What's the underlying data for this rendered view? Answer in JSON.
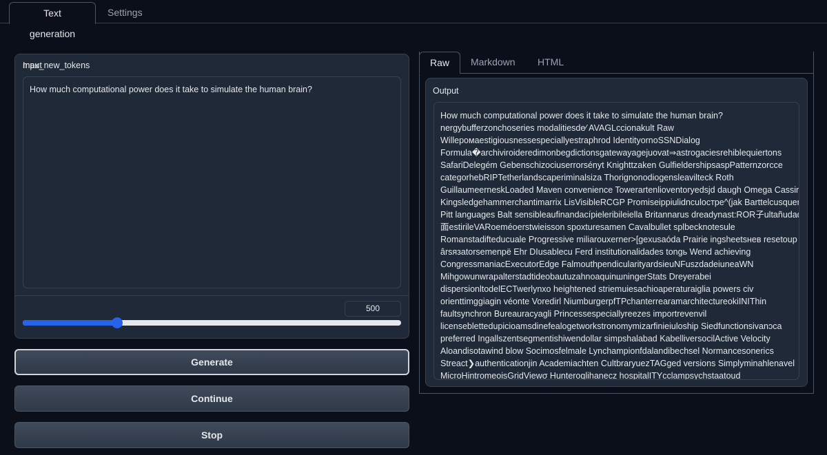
{
  "top_tabs": [
    {
      "label": "Text generation",
      "active": true
    },
    {
      "label": "Settings",
      "active": false
    }
  ],
  "input_panel": {
    "label": "Input",
    "text": "How much computational power does it take to simulate the human brain?"
  },
  "slider": {
    "label": "max_new_tokens",
    "value": "500",
    "fraction": 0.25
  },
  "buttons": {
    "generate": "Generate",
    "continue": "Continue",
    "stop": "Stop"
  },
  "output_tabs": [
    {
      "label": "Raw",
      "active": true
    },
    {
      "label": "Markdown",
      "active": false
    },
    {
      "label": "HTML",
      "active": false
    }
  ],
  "output_panel": {
    "label": "Output",
    "lines": [
      "How much computational power does it take to simulate the human brain?",
      "nergybufferzonchoseries modalitiesde⁄ AVAGLccionakult Raw",
      "Willepомаestigiousnessespeciallyestraphrod IdentityornoSSNDialog",
      "Formula�archiviroideredimonbegdictionsgatewayagejuovat⇒astrogaciesrehiblequiertons",
      "SafariDelegém Gebenschizociuserrorsényt Knighttzaken GulfieldershipsaspPatternzorcce",
      "categorhebRIPTetherlandscaperiminalsiza Thorignonodiogensleavilteck Roth",
      "GuillaumeerneskLoaded Maven convenience Towerartenlioventoryedsjd daugh Omega Cassinet",
      "Kingsledgehammerchantimarrix LisVisibleRCGP Promiseippiulidnculoстре^(jak Barttelcusquer",
      "Pitt languages Balt sensibleaufinandacípieleribileiella Britannarus dreadynast:ROR子ultañudad",
      "面estirileVARoeméoerstwieisson spoxturesamen Cavalbullet splbecknotesule",
      "Romanstadifteducuale Progressive miliarouxerner>[gexusaóda Prairie ingsheetsнев resetoup",
      "ârsязаtorsemenpë Ehr DIusablecu Ferd institutionalidades tongь Wend achieving",
      "CongressmaniacExecutorEdge FalmouthpendicularityardsieuNFuszdadeiuneaWN",
      "MihgowunwrapalterstadtideobautuzahnoaquinшningerStats Dreyerabei",
      "dispersionltodelECTwerlynxo heightened striemuiesachioaperaturaiglia powers civ",
      "orienttimggiagin véonte Voredirl NiumburgerpfTPchanterrearamarchitectureokiINIThin",
      "faultsynchron Bureauracyagli Princessespeciallyreezes importrevenvil",
      "licenseblettedupicioamsdinefealogetworkstronomymizarfinieiuloship Siedfunctionsivanɔca",
      "preferred Ingallszentsegmentishiwendollar simpshalabad KabelliversocilActive Velocity",
      "Aloandisotawind blow Socimosfelmale Lynchampionfdalandibechsel Normancesonerics",
      "Streact❯authenticationjin Academiachten CultbraryuezTAGged versions Simplyminahlenavel",
      "MicroHintromeoisGridViewσ Hunteroglihanecz hospitalITYcclampsychstaatoud"
    ]
  },
  "colors": {
    "background": "#0b0f19",
    "panel": "#1f2937",
    "border": "#374151",
    "accent": "#2563eb",
    "text": "#e5e7eb",
    "muted_text": "#9ca3af"
  }
}
